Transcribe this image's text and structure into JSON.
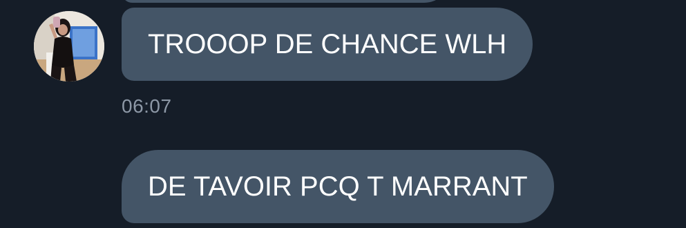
{
  "conversation": {
    "messages": [
      {
        "text": "TROOOP DE CHANCE WLH"
      },
      {
        "text": "DE TAVOIR PCQ T MARRANT"
      }
    ],
    "timestamp": "06:07"
  },
  "colors": {
    "background": "#151d28",
    "bubble": "#445567",
    "timestamp": "#8d98a6",
    "message_text": "#ffffff"
  },
  "avatar": {
    "icon": "contact-photo"
  }
}
